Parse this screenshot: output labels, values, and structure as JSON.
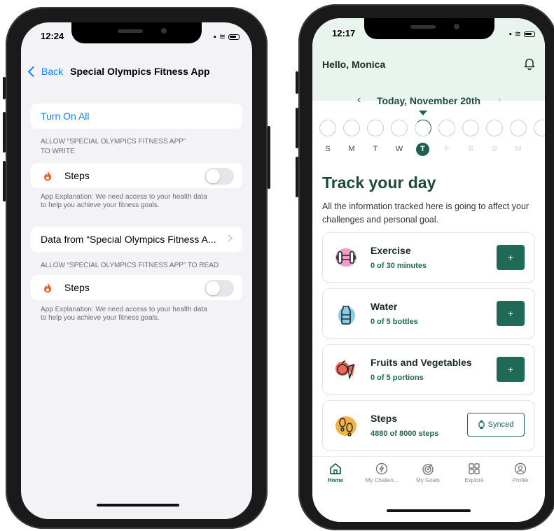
{
  "left_phone": {
    "status_time": "12:24",
    "nav": {
      "back_label": "Back",
      "title": "Special Olympics Fitness App"
    },
    "turn_on_all": "Turn On All",
    "write_section": {
      "header_line1": "ALLOW “SPECIAL OLYMPICS FITNESS APP”",
      "header_line2": "TO WRITE",
      "item_label": "Steps",
      "item_icon": "flame-icon",
      "toggle_on": false,
      "explanation_line1": "App Explanation: We need access to your health data",
      "explanation_line2": "to help you achieve your fitness goals."
    },
    "data_from_label": "Data from “Special Olympics Fitness A...",
    "read_section": {
      "header": "ALLOW “SPECIAL OLYMPICS FITNESS APP” TO READ",
      "item_label": "Steps",
      "item_icon": "flame-icon",
      "toggle_on": false,
      "explanation_line1": "App Explanation: We need access to your health data",
      "explanation_line2": "to help you achieve your fitness goals."
    }
  },
  "right_phone": {
    "status_time": "12:17",
    "greeting": "Hello, Monica",
    "date_label": "Today, November 20th",
    "days": [
      {
        "letter": "S",
        "state": "past"
      },
      {
        "letter": "M",
        "state": "past"
      },
      {
        "letter": "T",
        "state": "past"
      },
      {
        "letter": "W",
        "state": "past"
      },
      {
        "letter": "T",
        "state": "today"
      },
      {
        "letter": "F",
        "state": "future"
      },
      {
        "letter": "S",
        "state": "future"
      },
      {
        "letter": "S",
        "state": "future"
      },
      {
        "letter": "M",
        "state": "future"
      }
    ],
    "track_title": "Track your day",
    "track_description": "All the information tracked here is going to affect your challenges and personal goal.",
    "cards": [
      {
        "title": "Exercise",
        "subtitle": "0 of 30 minutes",
        "icon": "dumbbell-icon",
        "action": "plus",
        "action_label": "+"
      },
      {
        "title": "Water",
        "subtitle": "0 of 5 bottles",
        "icon": "water-bottle-icon",
        "action": "plus",
        "action_label": "+"
      },
      {
        "title": "Fruits and Vegetables",
        "subtitle": "0 of 5 portions",
        "icon": "fruit-icon",
        "action": "plus",
        "action_label": "+"
      },
      {
        "title": "Steps",
        "subtitle": "4880 of 8000 steps",
        "icon": "footsteps-icon",
        "action": "synced",
        "action_label": "Synced"
      }
    ],
    "tabs": [
      {
        "label": "Home",
        "icon": "home-icon",
        "active": true
      },
      {
        "label": "My Challen...",
        "icon": "challenge-icon",
        "active": false
      },
      {
        "label": "My Goals",
        "icon": "goals-icon",
        "active": false
      },
      {
        "label": "Explore",
        "icon": "grid-icon",
        "active": false
      },
      {
        "label": "Profile",
        "icon": "profile-icon",
        "active": false
      }
    ]
  },
  "colors": {
    "ios_blue": "#0a84ff",
    "app_green": "#1e6a56",
    "header_mint": "#e9f4ee"
  }
}
